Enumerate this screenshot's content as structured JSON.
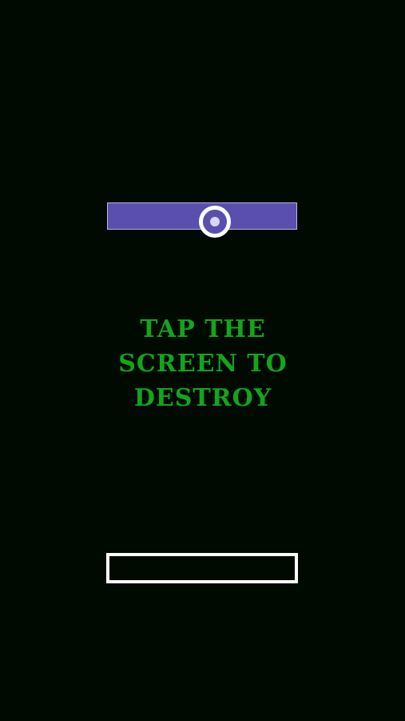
{
  "game": {
    "instruction": "TAP THE\nSCREEN TO\nDESTROY"
  },
  "colors": {
    "background": "#000a00",
    "top_bar": "#5a4fae",
    "text": "#13a51c",
    "outline": "#ffffff"
  },
  "icons": {
    "target": "ring-target-icon"
  }
}
